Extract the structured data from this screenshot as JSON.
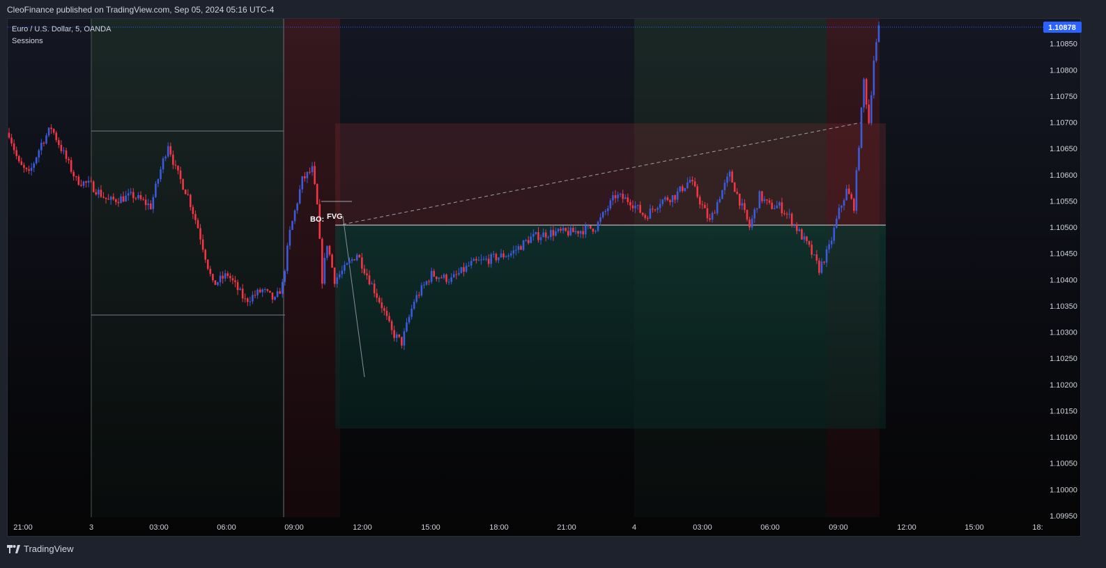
{
  "header": {
    "published": "CleoFinance published on TradingView.com, Sep 05, 2024 05:16 UTC-4"
  },
  "legend": {
    "symbol": "Euro / U.S. Dollar, 5, OANDA",
    "indicator": "Sessions"
  },
  "footer": {
    "brand": "TradingView"
  },
  "colors": {
    "bull": "#3b5bdb",
    "bear": "#f23645",
    "price_tag": "#2962ff",
    "asia_session": "#1b2a22",
    "london_session": "#3a1518",
    "target_zone": "#0c2a25",
    "stop_zone": "#3a1a1e"
  },
  "chart_data": {
    "type": "candlestick",
    "symbol": "EURUSD",
    "timeframe": "5",
    "last_price": "1.10878",
    "y_ticks": [
      "1.10850",
      "1.10800",
      "1.10750",
      "1.10700",
      "1.10650",
      "1.10600",
      "1.10550",
      "1.10500",
      "1.10450",
      "1.10400",
      "1.10350",
      "1.10300",
      "1.10250",
      "1.10200",
      "1.10150",
      "1.10100",
      "1.10050",
      "1.10000",
      "1.09950"
    ],
    "x_ticks": [
      "21:00",
      "3",
      "03:00",
      "06:00",
      "09:00",
      "12:00",
      "15:00",
      "18:00",
      "21:00",
      "4",
      "03:00",
      "06:00",
      "09:00",
      "12:00",
      "15:00",
      "18:"
    ],
    "ylim": [
      1.0995,
      1.109
    ],
    "annotations": [
      "BO:",
      "FVG"
    ],
    "waypoints": [
      [
        0,
        1.1068
      ],
      [
        4,
        1.1062
      ],
      [
        8,
        1.106
      ],
      [
        13,
        1.1066
      ],
      [
        17,
        1.1069
      ],
      [
        22,
        1.1064
      ],
      [
        27,
        1.1059
      ],
      [
        33,
        1.1058
      ],
      [
        40,
        1.1055
      ],
      [
        50,
        1.1056
      ],
      [
        57,
        1.1054
      ],
      [
        61,
        1.1061
      ],
      [
        64,
        1.1066
      ],
      [
        67,
        1.1061
      ],
      [
        72,
        1.1056
      ],
      [
        76,
        1.105
      ],
      [
        82,
        1.1039
      ],
      [
        88,
        1.1041
      ],
      [
        95,
        1.1036
      ],
      [
        102,
        1.1038
      ],
      [
        107,
        1.1036
      ],
      [
        110,
        1.1039
      ],
      [
        113,
        1.1049
      ],
      [
        118,
        1.1059
      ],
      [
        122,
        1.1061
      ],
      [
        124,
        1.1054
      ],
      [
        126,
        1.104
      ],
      [
        128,
        1.1047
      ],
      [
        131,
        1.104
      ],
      [
        135,
        1.1042
      ],
      [
        140,
        1.1045
      ],
      [
        145,
        1.104
      ],
      [
        150,
        1.1035
      ],
      [
        154,
        1.103
      ],
      [
        158,
        1.1028
      ],
      [
        163,
        1.1036
      ],
      [
        170,
        1.1041
      ],
      [
        178,
        1.104
      ],
      [
        186,
        1.1043
      ],
      [
        194,
        1.1044
      ],
      [
        202,
        1.1045
      ],
      [
        210,
        1.1048
      ],
      [
        218,
        1.1049
      ],
      [
        226,
        1.1049
      ],
      [
        236,
        1.105
      ],
      [
        244,
        1.1056
      ],
      [
        250,
        1.1055
      ],
      [
        256,
        1.1052
      ],
      [
        262,
        1.1055
      ],
      [
        268,
        1.1056
      ],
      [
        274,
        1.1059
      ],
      [
        278,
        1.1055
      ],
      [
        282,
        1.1051
      ],
      [
        286,
        1.1056
      ],
      [
        290,
        1.106
      ],
      [
        294,
        1.1055
      ],
      [
        298,
        1.105
      ],
      [
        302,
        1.1056
      ],
      [
        306,
        1.1054
      ],
      [
        310,
        1.1054
      ],
      [
        314,
        1.1052
      ],
      [
        318,
        1.1049
      ],
      [
        322,
        1.1046
      ],
      [
        326,
        1.1042
      ],
      [
        330,
        1.1046
      ],
      [
        334,
        1.1053
      ],
      [
        337,
        1.1057
      ],
      [
        340,
        1.1054
      ],
      [
        342,
        1.1066
      ],
      [
        344,
        1.1078
      ],
      [
        346,
        1.107
      ],
      [
        348,
        1.1082
      ],
      [
        350,
        1.10878
      ]
    ]
  }
}
